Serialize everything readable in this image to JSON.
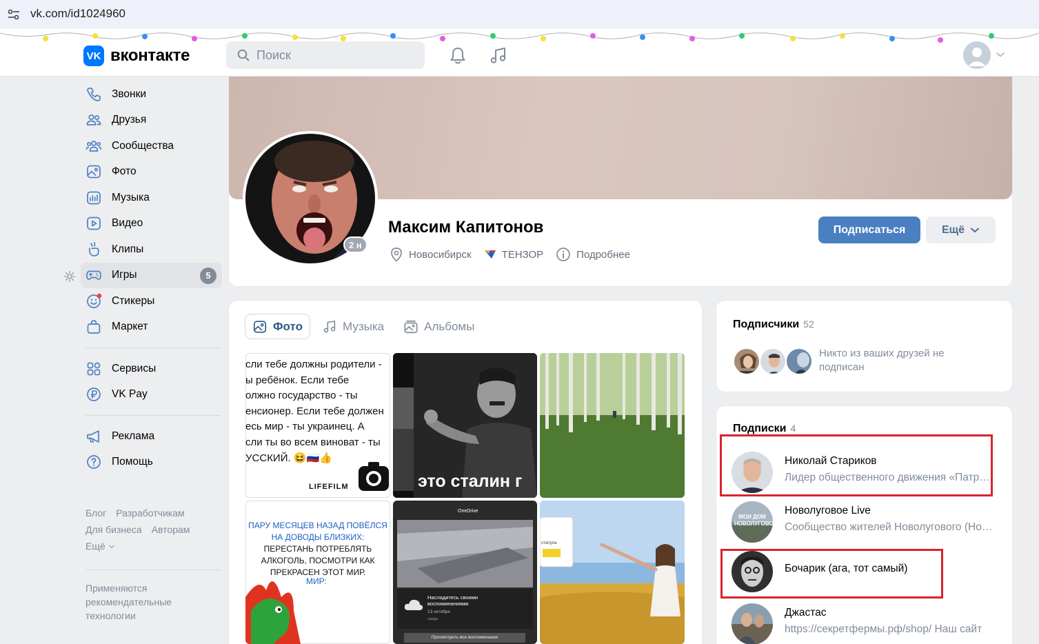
{
  "browser": {
    "url": "vk.com/id1024960"
  },
  "header": {
    "logo_text": "вконтакте",
    "search_placeholder": "Поиск",
    "icons": [
      "bell-icon",
      "music-note-icon"
    ]
  },
  "nav": {
    "items": [
      {
        "label": "Звонки",
        "icon": "phone-icon"
      },
      {
        "label": "Друзья",
        "icon": "friends-icon"
      },
      {
        "label": "Сообщества",
        "icon": "communities-icon"
      },
      {
        "label": "Фото",
        "icon": "photo-icon"
      },
      {
        "label": "Музыка",
        "icon": "music-icon"
      },
      {
        "label": "Видео",
        "icon": "video-icon"
      },
      {
        "label": "Клипы",
        "icon": "clips-icon"
      },
      {
        "label": "Игры",
        "icon": "gamepad-icon",
        "badge": "5"
      },
      {
        "label": "Стикеры",
        "icon": "sticker-icon"
      },
      {
        "label": "Маркет",
        "icon": "bag-icon"
      }
    ],
    "items2": [
      {
        "label": "Сервисы",
        "icon": "services-icon"
      },
      {
        "label": "VK Pay",
        "icon": "ruble-icon"
      }
    ],
    "items3": [
      {
        "label": "Реклама",
        "icon": "megaphone-icon"
      },
      {
        "label": "Помощь",
        "icon": "help-icon"
      }
    ],
    "footer_links": [
      "Блог",
      "Разработчикам",
      "Для бизнеса",
      "Авторам",
      "Ещё"
    ],
    "footer_note": "Применяются рекомендательные технологии"
  },
  "profile": {
    "name": "Максим Капитонов",
    "online": "2 н",
    "city": "Новосибирск",
    "company": "ТЕНЗОР",
    "details": "Подробнее",
    "subscribe_label": "Подписаться",
    "more_label": "Ещё"
  },
  "media": {
    "tabs": [
      {
        "label": "Фото",
        "icon": "photo-icon",
        "active": true
      },
      {
        "label": "Музыка",
        "icon": "music-icon",
        "active": false
      },
      {
        "label": "Альбомы",
        "icon": "albums-icon",
        "active": false
      }
    ],
    "meme1_lines": "сли тебе должны родители -\nы ребёнок. Если тебе\nолжно государство - ты\nенсионер. Если тебе должен\nесь мир - ты украинец. А\nсли ты во всем виноват - ты\nУССКИЙ. 😆🇷🇺👍",
    "meme1_footer": "LIFEFILM",
    "meme_caption": "это сталин г",
    "meme2_text": "пару месяцев назад повёлся на доводы близких:",
    "meme2_text_b": "перестань потреблять алкоголь, посмотри как прекрасен этот мир.",
    "meme2_mir": "МИР:",
    "onedrive_title": "OneDrive",
    "onedrive_msg": "Насладитесь своими воспоминаниями",
    "onedrive_date": "13 октября",
    "onedrive_sub": "среда",
    "onedrive_btn": "Просмотреть все воспоминания",
    "status_snippet": "статусе"
  },
  "followers": {
    "title": "Подписчики",
    "count": "52",
    "note": "Никто из ваших друзей не подписан"
  },
  "subscriptions": {
    "title": "Подписки",
    "count": "4",
    "items": [
      {
        "name": "Николай Стариков",
        "desc": "Лидер общественного движения «Патриоты Великого Отечества»"
      },
      {
        "name": "Новолуговое Live",
        "desc": "Сообщество жителей Новолугового (Новосибирская область)"
      },
      {
        "name": "Бочарик (ага, тот самый)",
        "desc": ""
      },
      {
        "name": "Джастас",
        "desc": "https://секретфермы.рф/shop/ Наш сайт"
      }
    ],
    "avatar_text_2": "МОИ ДОМ НОВОЛУГОВОЕ"
  },
  "colors": {
    "accent": "#4a80c2",
    "link": "#2a5885",
    "highlight_box": "#d9232f",
    "background": "#edeef0"
  }
}
